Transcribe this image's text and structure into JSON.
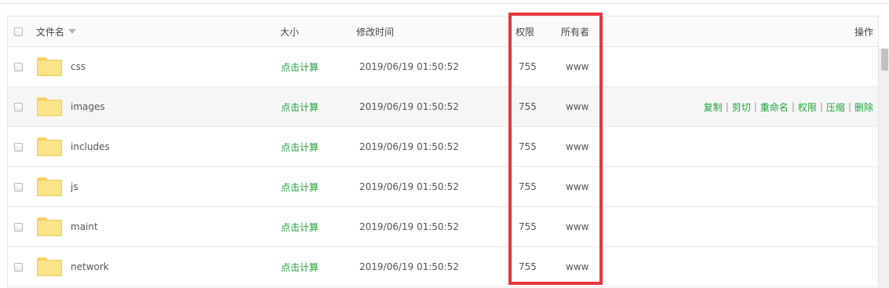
{
  "table": {
    "headers": {
      "name": "文件名",
      "size": "大小",
      "mtime": "修改时间",
      "perm": "权限",
      "owner": "所有者",
      "actions": "操作"
    },
    "rows": [
      {
        "name": "css",
        "size": "点击计算",
        "mtime": "2019/06/19 01:50:52",
        "perm": "755",
        "owner": "www"
      },
      {
        "name": "images",
        "size": "点击计算",
        "mtime": "2019/06/19 01:50:52",
        "perm": "755",
        "owner": "www"
      },
      {
        "name": "includes",
        "size": "点击计算",
        "mtime": "2019/06/19 01:50:52",
        "perm": "755",
        "owner": "www"
      },
      {
        "name": "js",
        "size": "点击计算",
        "mtime": "2019/06/19 01:50:52",
        "perm": "755",
        "owner": "www"
      },
      {
        "name": "maint",
        "size": "点击计算",
        "mtime": "2019/06/19 01:50:52",
        "perm": "755",
        "owner": "www"
      },
      {
        "name": "network",
        "size": "点击计算",
        "mtime": "2019/06/19 01:50:52",
        "perm": "755",
        "owner": "www"
      }
    ],
    "row_actions": {
      "copy": "复制",
      "cut": "剪切",
      "rename": "重命名",
      "perm": "权限",
      "compress": "压缩",
      "delete": "删除",
      "separator": "|"
    }
  },
  "colors": {
    "accent_green": "#20a53a",
    "highlight_red": "#e7373d",
    "folder_yellow": "#fbe387"
  },
  "icons": {
    "folder": "folder-icon",
    "sort": "sort-desc-icon",
    "checkbox": "checkbox-icon"
  }
}
